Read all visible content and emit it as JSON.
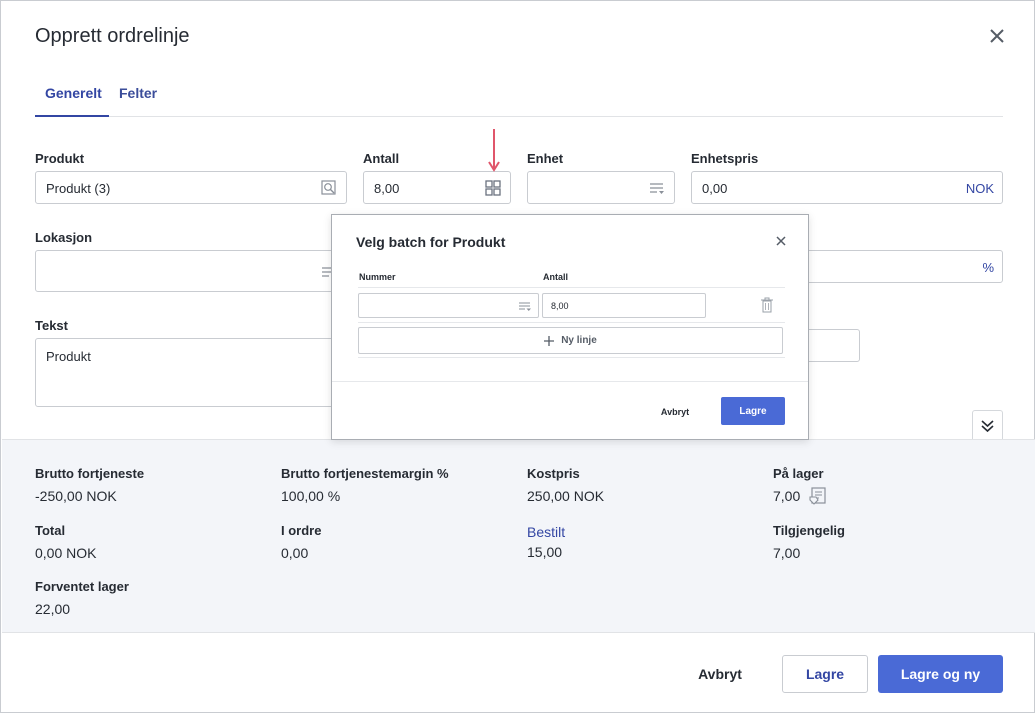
{
  "dialog": {
    "title": "Opprett ordrelinje",
    "tabs": [
      {
        "label": "Generelt",
        "active": true
      },
      {
        "label": "Felter",
        "active": false
      }
    ]
  },
  "form": {
    "produkt": {
      "label": "Produkt",
      "value": "Produkt (3)"
    },
    "antall": {
      "label": "Antall",
      "value": "8,00"
    },
    "enhet": {
      "label": "Enhet",
      "value": ""
    },
    "enhetspris": {
      "label": "Enhetspris",
      "value": "0,00",
      "currency": "NOK"
    },
    "lokasjon": {
      "label": "Lokasjon",
      "value": ""
    },
    "rabatt": {
      "value": "",
      "suffix": "%"
    },
    "tekst": {
      "label": "Tekst",
      "value": "Produkt"
    }
  },
  "summary": {
    "brutto_fortjeneste": {
      "label": "Brutto fortjeneste",
      "value": "-250,00 NOK"
    },
    "brutto_margin": {
      "label": "Brutto fortjenestemargin %",
      "value": "100,00 %"
    },
    "kostpris": {
      "label": "Kostpris",
      "value": "250,00 NOK"
    },
    "pa_lager": {
      "label": "På lager",
      "value": "7,00"
    },
    "total": {
      "label": "Total",
      "value": "0,00 NOK"
    },
    "i_ordre": {
      "label": "I ordre",
      "value": "0,00"
    },
    "bestilt": {
      "label": "Bestilt",
      "value": "15,00"
    },
    "tilgjengelig": {
      "label": "Tilgjengelig",
      "value": "7,00"
    },
    "forventet_lager": {
      "label": "Forventet lager",
      "value": "22,00"
    }
  },
  "footer": {
    "cancel_label": "Avbryt",
    "save_label": "Lagre",
    "save_new_label": "Lagre og ny"
  },
  "batch_popup": {
    "title": "Velg batch for Produkt",
    "col_number": "Nummer",
    "col_quantity": "Antall",
    "row": {
      "number": "",
      "quantity": "8,00"
    },
    "new_line_label": "Ny linje",
    "cancel_label": "Avbryt",
    "save_label": "Lagre"
  },
  "colors": {
    "primary": "#4a6ad6",
    "link": "#3346a3",
    "annotation_arrow": "#e0566b",
    "summary_bg": "#f3f5f9"
  },
  "icons": [
    "close-icon",
    "search-icon",
    "grid-icon",
    "list-filter-icon",
    "trash-icon",
    "plus-icon",
    "chevron-double-down-icon",
    "stock-list-icon"
  ]
}
